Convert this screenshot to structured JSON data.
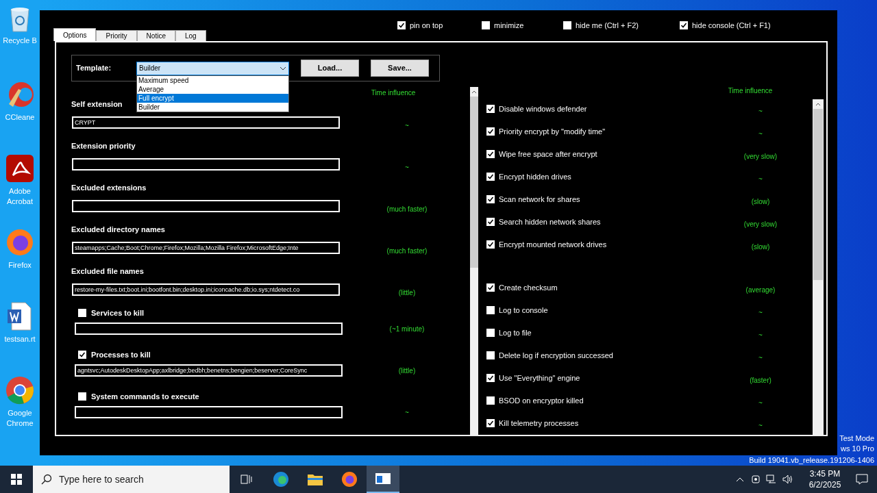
{
  "desktop_icons": [
    {
      "label": "Recycle B",
      "kind": "bin"
    },
    {
      "label": "CCleane",
      "kind": "cleaner"
    },
    {
      "label": "Adobe Acrobat",
      "kind": "pdf"
    },
    {
      "label": "Firefox",
      "kind": "firefox"
    },
    {
      "label": "testsan.rt",
      "kind": "doc"
    },
    {
      "label": "Google Chrome",
      "kind": "chrome"
    }
  ],
  "window": {
    "tabs": [
      {
        "label": "Options",
        "selected": true
      },
      {
        "label": "Priority",
        "selected": false
      },
      {
        "label": "Notice",
        "selected": false
      },
      {
        "label": "Log",
        "selected": false
      }
    ],
    "top_options": [
      {
        "label": "pin on top",
        "checked": true
      },
      {
        "label": "minimize",
        "checked": false
      },
      {
        "label": "hide me (Ctrl + F2)",
        "checked": false
      },
      {
        "label": "hide console (Ctrl + F1)",
        "checked": true
      }
    ],
    "template": {
      "label": "Template:",
      "value": "Builder",
      "options": [
        {
          "label": "Maximum speed",
          "highlighted": false
        },
        {
          "label": "Average",
          "highlighted": false
        },
        {
          "label": "Full encrypt",
          "highlighted": true
        },
        {
          "label": "Builder",
          "highlighted": false
        }
      ],
      "buttons": [
        "Load...",
        "Save..."
      ]
    },
    "left_header": "Time influence",
    "left_options": [
      {
        "kind": "text",
        "label": "Self extension",
        "value": "CRYPT",
        "influence": "~"
      },
      {
        "kind": "text",
        "label": "Extension priority",
        "influence": "~"
      },
      {
        "kind": "text",
        "label": "Excluded extensions",
        "influence": "(much faster)"
      },
      {
        "kind": "text",
        "label": "Excluded directory names",
        "value": "steamapps;Cache;Boot;Chrome;Firefox;Mozilla;Mozilla Firefox;MicrosoftEdge;Inte",
        "influence": "(much faster)"
      },
      {
        "kind": "text",
        "label": "Excluded file names",
        "value": "restore-my-files.txt;boot.ini;bootfont.bin;desktop.ini;iconcache.db;io.sys;ntdetect.co",
        "influence": "(little)"
      },
      {
        "kind": "check",
        "label": "Services to kill",
        "checked": false,
        "influence": "(~1 minute)"
      },
      {
        "kind": "check",
        "label": "Processes to kill",
        "checked": true,
        "value": "agntsvc;AutodeskDesktopApp;axlbridge;bedbh;benetns;bengien;beserver;CoreSync",
        "influence": "(little)"
      },
      {
        "kind": "check",
        "label": "System commands to execute",
        "checked": false,
        "influence": "~"
      }
    ],
    "right_header": "Time influence",
    "right_groups": [
      [
        {
          "label": "Disable windows defender",
          "checked": true,
          "influence": "~"
        },
        {
          "label": "Priority encrypt by \"modify time\"",
          "checked": true,
          "influence": "~"
        },
        {
          "label": "Wipe free space after encrypt",
          "checked": true,
          "influence": "(very slow)"
        },
        {
          "label": "Encrypt hidden drives",
          "checked": true,
          "influence": "~"
        },
        {
          "label": "Scan network for shares",
          "checked": true,
          "influence": "(slow)"
        },
        {
          "label": "Search hidden network shares",
          "checked": true,
          "influence": "(very slow)"
        },
        {
          "label": "Encrypt mounted network drives",
          "checked": true,
          "influence": "(slow)"
        }
      ],
      [
        {
          "label": "Create checksum",
          "checked": true,
          "influence": "(average)"
        },
        {
          "label": "Log to console",
          "checked": false,
          "influence": "~"
        },
        {
          "label": "Log to file",
          "checked": false,
          "influence": "~"
        },
        {
          "label": "Delete log if encryption successed",
          "checked": false,
          "influence": "~"
        },
        {
          "label": "Use \"Everything\" engine",
          "checked": true,
          "influence": "(faster)"
        },
        {
          "label": "BSOD on encryptor killed",
          "checked": false,
          "influence": "~"
        },
        {
          "label": "Kill telemetry processes",
          "checked": true,
          "influence": "~"
        }
      ]
    ]
  },
  "desktop_text": [
    "Test Mode",
    "ws 10 Pro"
  ],
  "build": "Build 19041.vb_release.191206-1406",
  "taskbar": {
    "search_placeholder": "Type here to search",
    "time": "3:45 PM",
    "date": "6/2/2025"
  }
}
